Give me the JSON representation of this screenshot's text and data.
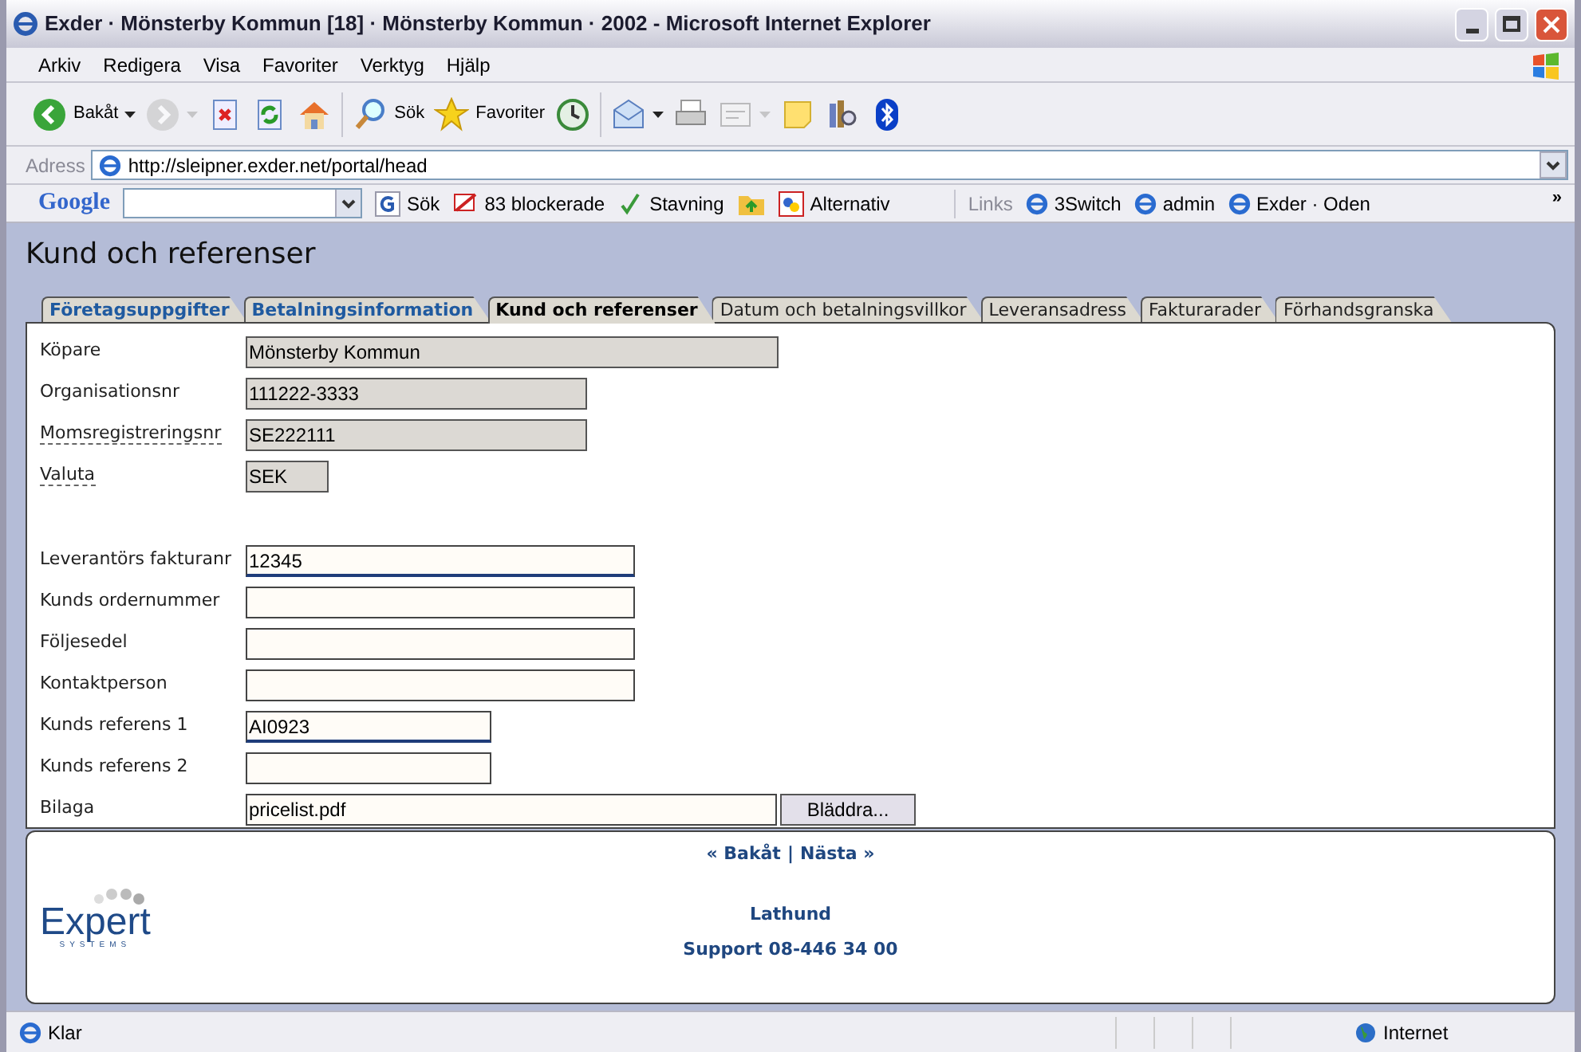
{
  "window": {
    "title": "Exder · Mönsterby Kommun [18] · Mönsterby Kommun · 2002 - Microsoft Internet Explorer"
  },
  "menu": [
    "Arkiv",
    "Redigera",
    "Visa",
    "Favoriter",
    "Verktyg",
    "Hjälp"
  ],
  "toolbar": [
    {
      "label": "Bakåt",
      "dropdown": true,
      "disabled": false
    },
    {
      "dropdown": true,
      "disabled": true
    },
    {
      "dropdown": false,
      "disabled": false
    },
    {
      "dropdown": false,
      "disabled": false
    },
    {
      "dropdown": false,
      "disabled": false
    },
    {
      "label": "Sök",
      "dropdown": false,
      "disabled": false
    },
    {
      "label": "Favoriter",
      "dropdown": false,
      "disabled": false
    },
    {
      "dropdown": false,
      "disabled": false
    },
    {
      "dropdown": true,
      "disabled": false
    },
    {
      "dropdown": false,
      "disabled": false
    },
    {
      "dropdown": true,
      "disabled": true
    },
    {
      "dropdown": false,
      "disabled": false
    },
    {
      "dropdown": false,
      "disabled": false
    },
    {
      "dropdown": false,
      "disabled": false
    }
  ],
  "address": {
    "label": "Adress",
    "value": "http://sleipner.exder.net/portal/head"
  },
  "google_bar": {
    "logo": "Google",
    "search": "Sök",
    "blocked": "83 blockerade",
    "spelling": "Stavning",
    "options": "Alternativ"
  },
  "links": {
    "label": "Links",
    "items": [
      "3Switch",
      "admin",
      "Exder · Oden"
    ],
    "more": "»"
  },
  "page": {
    "title": "Kund och referenser",
    "tabs": [
      {
        "label": "Företagsuppgifter",
        "selected": false,
        "completed": true
      },
      {
        "label": "Betalningsinformation",
        "selected": false,
        "completed": true
      },
      {
        "label": "Kund och referenser",
        "selected": true,
        "completed": false
      },
      {
        "label": "Datum och betalningsvillkor",
        "selected": false,
        "completed": false
      },
      {
        "label": "Leveransadress",
        "selected": false,
        "completed": false
      },
      {
        "label": "Fakturarader",
        "selected": false,
        "completed": false
      },
      {
        "label": "Förhandsgranska",
        "selected": false,
        "completed": false
      }
    ],
    "fields": [
      {
        "label": "Köpare",
        "value": "Mönsterby Kommun",
        "readonly": true,
        "hint": false,
        "focused": false
      },
      {
        "label": "Organisationsnr",
        "value": "111222-3333",
        "readonly": true,
        "hint": false,
        "focused": false
      },
      {
        "label": "Momsregistreringsnr",
        "value": "SE222111",
        "readonly": true,
        "hint": true,
        "focused": false
      },
      {
        "label": "Valuta",
        "value": "SEK",
        "readonly": true,
        "hint": true,
        "focused": false
      },
      {
        "label": "Leverantörs fakturanr",
        "value": "12345",
        "readonly": false,
        "hint": false,
        "focused": true
      },
      {
        "label": "Kunds ordernummer",
        "readonly": false,
        "hint": false,
        "focused": false
      },
      {
        "label": "Följesedel",
        "readonly": false,
        "hint": false,
        "focused": false
      },
      {
        "label": "Kontaktperson",
        "readonly": false,
        "hint": false,
        "focused": false
      },
      {
        "label": "Kunds referens 1",
        "value": "AI0923",
        "readonly": false,
        "hint": false,
        "focused": true
      },
      {
        "label": "Kunds referens 2",
        "readonly": false,
        "hint": false,
        "focused": false
      },
      {
        "label": "Bilaga",
        "value": "pricelist.pdf",
        "readonly": false,
        "hint": false,
        "focused": false,
        "button": "Bläddra..."
      }
    ],
    "nav": {
      "back": "« Bakåt",
      "separator": "|",
      "next": "Nästa »"
    },
    "logo": {
      "name": "Expert",
      "sub": "SYSTEMS"
    },
    "help": "Lathund",
    "support": "Support 08-446 34 00"
  },
  "status_bar": {
    "text": "Klar",
    "zone": "Internet"
  }
}
